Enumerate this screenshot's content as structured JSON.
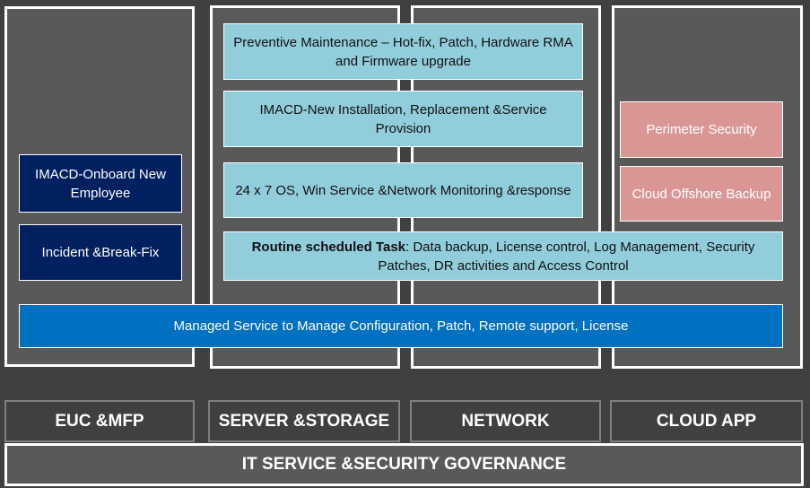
{
  "columns": {
    "euc": {
      "items": [
        "IMACD-Onboard New Employee",
        "Incident &Break-Fix"
      ]
    },
    "server_network": {
      "items": [
        "Preventive Maintenance – Hot-fix, Patch, Hardware RMA and Firmware upgrade",
        "IMACD-New Installation, Replacement &Service Provision",
        "24 x 7 OS, Win Service &Network Monitoring &response"
      ]
    },
    "cloud": {
      "items": [
        "Perimeter Security",
        "Cloud Offshore Backup"
      ]
    },
    "routine": {
      "bold": "Routine scheduled Task",
      "text": ": Data backup, License control, Log Management, Security Patches, DR activities and Access Control"
    },
    "managed": "Managed Service to Manage Configuration, Patch, Remote support, License"
  },
  "categories": [
    "EUC &MFP",
    "SERVER &STORAGE",
    "NETWORK",
    "CLOUD APP"
  ],
  "governance": "IT SERVICE &SECURITY GOVERNANCE",
  "colors": {
    "background": "#404040",
    "panel": "#595959",
    "light_blue": "#92cddc",
    "navy": "#002060",
    "pink": "#d99694",
    "blue": "#0070c0"
  }
}
